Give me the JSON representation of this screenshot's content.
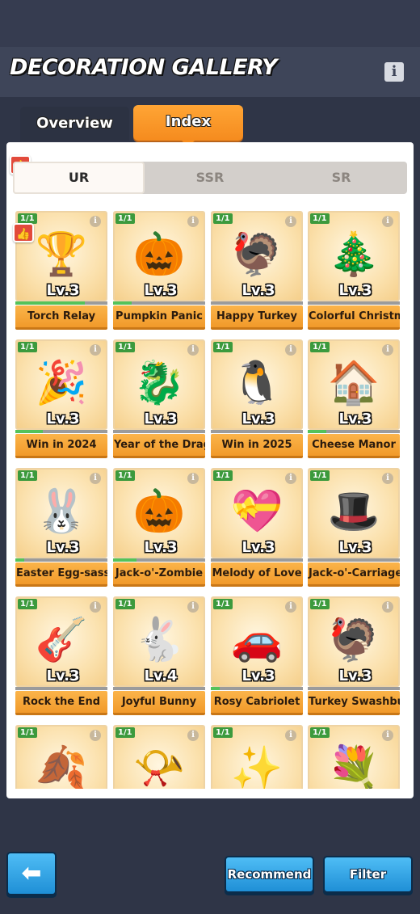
{
  "header": {
    "title": "DECORATION GALLERY",
    "info_icon": "info-icon"
  },
  "tabs": [
    {
      "label": "Overview",
      "active": false
    },
    {
      "label": "Index",
      "active": true
    }
  ],
  "rarity_tabs": [
    {
      "label": "UR",
      "active": true
    },
    {
      "label": "SSR",
      "active": false
    },
    {
      "label": "SR",
      "active": false
    }
  ],
  "cards": [
    {
      "count": "1/1",
      "level": "Lv.3",
      "name": "Torch Relay",
      "icon": "🏆",
      "progress": 0.75
    },
    {
      "count": "1/1",
      "level": "Lv.3",
      "name": "Pumpkin Panic",
      "icon": "🎃",
      "progress": 0.2
    },
    {
      "count": "1/1",
      "level": "Lv.3",
      "name": "Happy Turkey",
      "icon": "🦃",
      "progress": 0.0
    },
    {
      "count": "1/1",
      "level": "Lv.3",
      "name": "Colorful Christmas",
      "icon": "🎄",
      "progress": 0.0
    },
    {
      "count": "1/1",
      "level": "Lv.3",
      "name": "Win in 2024",
      "icon": "🎉",
      "progress": 0.3
    },
    {
      "count": "1/1",
      "level": "Lv.3",
      "name": "Year of the Dragon",
      "icon": "🐉",
      "progress": 0.0
    },
    {
      "count": "1/1",
      "level": "Lv.3",
      "name": "Win in 2025",
      "icon": "🐧",
      "progress": 0.0
    },
    {
      "count": "1/1",
      "level": "Lv.3",
      "name": "Cheese Manor",
      "icon": "🏠",
      "progress": 0.2
    },
    {
      "count": "1/1",
      "level": "Lv.3",
      "name": "Easter Egg-sassin",
      "icon": "🐰",
      "progress": 0.1
    },
    {
      "count": "1/1",
      "level": "Lv.3",
      "name": "Jack-o'-Zombie",
      "icon": "🎃",
      "progress": 0.25
    },
    {
      "count": "1/1",
      "level": "Lv.3",
      "name": "Melody of Love",
      "icon": "💝",
      "progress": 0.0
    },
    {
      "count": "1/1",
      "level": "Lv.3",
      "name": "Jack-o'-Carriage",
      "icon": "🎩",
      "progress": 0.0
    },
    {
      "count": "1/1",
      "level": "Lv.3",
      "name": "Rock the End",
      "icon": "🎸",
      "progress": 0.0
    },
    {
      "count": "1/1",
      "level": "Lv.4",
      "name": "Joyful Bunny",
      "icon": "🐇",
      "progress": 0.0
    },
    {
      "count": "1/1",
      "level": "Lv.3",
      "name": "Rosy Cabriolet",
      "icon": "🚗",
      "progress": 0.1
    },
    {
      "count": "1/1",
      "level": "Lv.3",
      "name": "Turkey Swashbuckler",
      "icon": "🦃",
      "progress": 0.0
    },
    {
      "count": "1/1",
      "level": "",
      "name": "",
      "icon": "🍂",
      "progress": 0.0
    },
    {
      "count": "1/1",
      "level": "",
      "name": "",
      "icon": "📯",
      "progress": 0.0
    },
    {
      "count": "1/1",
      "level": "",
      "name": "",
      "icon": "✨",
      "progress": 0.0
    },
    {
      "count": "1/1",
      "level": "",
      "name": "",
      "icon": "💐",
      "progress": 0.0
    }
  ],
  "footer": {
    "back_icon": "back-arrow-icon",
    "recommend_label": "Recommend",
    "filter_label": "Filter"
  },
  "colors": {
    "accent_orange": "#f58b1e",
    "button_blue": "#1f8fd6",
    "progress_green": "#54c25a",
    "badge_green": "#3c9a3d",
    "like_red": "#e24a3b"
  }
}
